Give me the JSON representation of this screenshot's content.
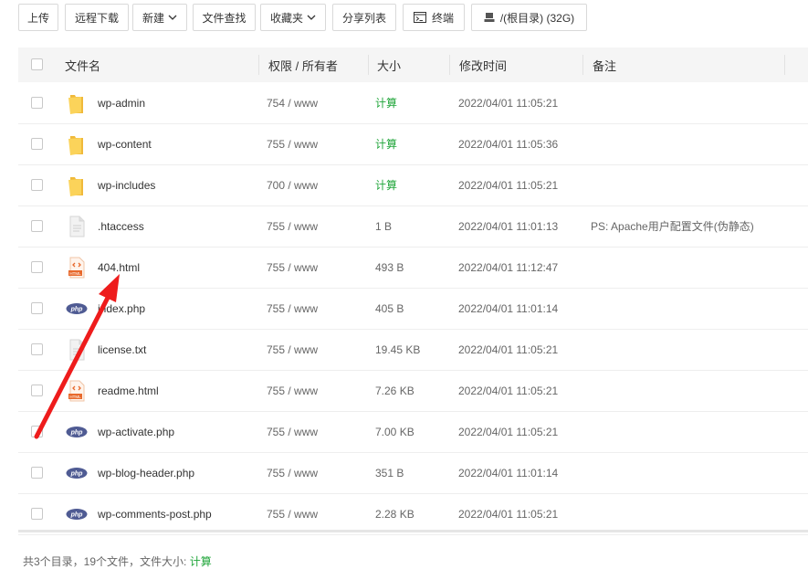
{
  "toolbar": {
    "upload": "上传",
    "remote_download": "远程下载",
    "new": "新建",
    "file_search": "文件查找",
    "favorites": "收藏夹",
    "share_list": "分享列表",
    "terminal": "终端",
    "disk": "/(根目录) (32G)"
  },
  "table": {
    "headers": {
      "name": "文件名",
      "perm": "权限 / 所有者",
      "size": "大小",
      "mtime": "修改时间",
      "note": "备注"
    },
    "rows": [
      {
        "name": "wp-admin",
        "perm": "754 / www",
        "size": "计算",
        "mtime": "2022/04/01 11:05:21",
        "note": "",
        "icon": "folder-icon",
        "calc": true
      },
      {
        "name": "wp-content",
        "perm": "755 / www",
        "size": "计算",
        "mtime": "2022/04/01 11:05:36",
        "note": "",
        "icon": "folder-icon",
        "calc": true
      },
      {
        "name": "wp-includes",
        "perm": "700 / www",
        "size": "计算",
        "mtime": "2022/04/01 11:05:21",
        "note": "",
        "icon": "folder-icon",
        "calc": true
      },
      {
        "name": ".htaccess",
        "perm": "755 / www",
        "size": "1 B",
        "mtime": "2022/04/01 11:01:13",
        "note": "PS: Apache用户配置文件(伪静态)",
        "icon": "text-file-icon",
        "calc": false
      },
      {
        "name": "404.html",
        "perm": "755 / www",
        "size": "493 B",
        "mtime": "2022/04/01 11:12:47",
        "note": "",
        "icon": "html-file-icon",
        "calc": false
      },
      {
        "name": "index.php",
        "perm": "755 / www",
        "size": "405 B",
        "mtime": "2022/04/01 11:01:14",
        "note": "",
        "icon": "php-file-icon",
        "calc": false
      },
      {
        "name": "license.txt",
        "perm": "755 / www",
        "size": "19.45 KB",
        "mtime": "2022/04/01 11:05:21",
        "note": "",
        "icon": "text-file-icon",
        "calc": false
      },
      {
        "name": "readme.html",
        "perm": "755 / www",
        "size": "7.26 KB",
        "mtime": "2022/04/01 11:05:21",
        "note": "",
        "icon": "html-file-icon",
        "calc": false
      },
      {
        "name": "wp-activate.php",
        "perm": "755 / www",
        "size": "7.00 KB",
        "mtime": "2022/04/01 11:05:21",
        "note": "",
        "icon": "php-file-icon",
        "calc": false
      },
      {
        "name": "wp-blog-header.php",
        "perm": "755 / www",
        "size": "351 B",
        "mtime": "2022/04/01 11:01:14",
        "note": "",
        "icon": "php-file-icon",
        "calc": false
      },
      {
        "name": "wp-comments-post.php",
        "perm": "755 / www",
        "size": "2.28 KB",
        "mtime": "2022/04/01 11:05:21",
        "note": "",
        "icon": "php-file-icon",
        "calc": false
      }
    ]
  },
  "footer": {
    "summary": "共3个目录，19个文件，文件大小:",
    "size_link": "计算"
  },
  "colors": {
    "calc_green": "#20a53a",
    "folder_yellow": "#f7c84a",
    "php_purple": "#4f5b93",
    "html_orange": "#e8692c",
    "arrow_red": "#ee1c1c"
  }
}
